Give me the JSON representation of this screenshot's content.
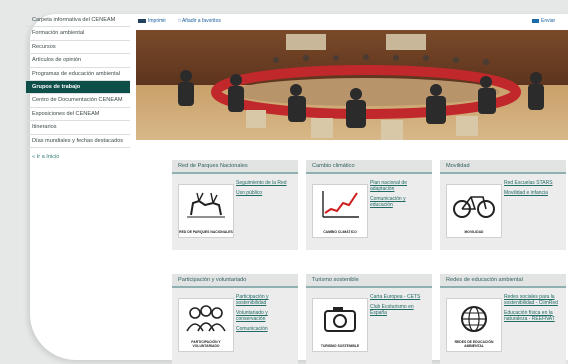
{
  "sidebar": {
    "items": [
      {
        "label": "Carpeta informativa del CENEAM",
        "active": false
      },
      {
        "label": "Formación ambiental",
        "active": false
      },
      {
        "label": "Recursos",
        "active": false
      },
      {
        "label": "Artículos de opinión",
        "active": false
      },
      {
        "label": "Programas de educación ambiental",
        "active": false
      },
      {
        "label": "Grupos de trabajo",
        "active": true
      },
      {
        "label": "Centro de Documentación CENEAM",
        "active": false
      },
      {
        "label": "Exposiciones del CENEAM",
        "active": false
      },
      {
        "label": "Itinerarios",
        "active": false
      },
      {
        "label": "Días mundiales y fechas destacados",
        "active": false
      }
    ],
    "back_label": "« Ir a Inicio"
  },
  "header": {
    "links": [
      "Imprimir",
      "Añadir a favoritos"
    ],
    "share_label": "Enviar"
  },
  "cards": [
    {
      "title": "Red de Parques Nacionales",
      "icon": "deer-icon",
      "caption": "RED DE PARQUES NACIONALES",
      "links": [
        "Seguimiento de la Red",
        "Uso público"
      ]
    },
    {
      "title": "Cambio climático",
      "icon": "rising-chart-icon",
      "caption": "CAMBIO CLIMÁTICO",
      "links": [
        "Plan nacional de adaptación",
        "Comunicación y educación"
      ]
    },
    {
      "title": "Movilidad",
      "icon": "bicycle-icon",
      "caption": "MOVILIDAD",
      "links": [
        "Red Escuelas STARS",
        "Movilidad e infancia"
      ]
    },
    {
      "title": "Participación y voluntariado",
      "icon": "people-icon",
      "caption": "PARTICIPACIÓN Y VOLUNTARIADO",
      "links": [
        "Participación y sostenibilidad",
        "Voluntariado y conservación",
        "Comunicación"
      ]
    },
    {
      "title": "Turismo sostenible",
      "icon": "camera-icon",
      "caption": "TURISMO SOSTENIBLE",
      "links": [
        "Carta Europea - CETS",
        "Club Ecoturismo en España"
      ]
    },
    {
      "title": "Redes de educación ambiental",
      "icon": "globe-icon",
      "caption": "REDES DE EDUCACIÓN AMBIENTAL",
      "links": [
        "Redes sociales para la sostenibilidad - ClimRed",
        "Educación física en la naturaleza - REEFNAT"
      ]
    }
  ]
}
